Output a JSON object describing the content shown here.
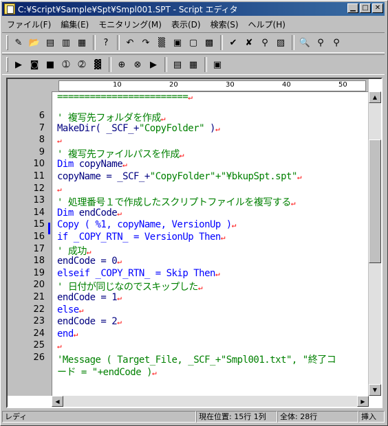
{
  "window": {
    "title": "C:¥Script¥Sample¥Spt¥Smpl001.SPT - Script エディタ"
  },
  "titlebar_buttons": [
    "▁",
    "□",
    "✕"
  ],
  "menu": [
    "ファイル(F)",
    "編集(E)",
    "モニタリング(M)",
    "表示(D)",
    "検索(S)",
    "ヘルプ(H)"
  ],
  "toolbar1": [
    {
      "name": "new-icon",
      "glyph": "✎"
    },
    {
      "name": "open-icon",
      "glyph": "📂"
    },
    {
      "name": "save-icon",
      "glyph": "▤"
    },
    {
      "name": "print-icon",
      "glyph": "▥"
    },
    {
      "name": "script-list-icon",
      "glyph": "▦"
    },
    {
      "sep": true
    },
    {
      "name": "help-icon",
      "glyph": "?"
    },
    {
      "sep": true
    },
    {
      "name": "undo-icon",
      "glyph": "↶"
    },
    {
      "name": "redo-icon",
      "glyph": "↷"
    },
    {
      "name": "cut-icon",
      "glyph": "▒"
    },
    {
      "name": "copy-icon",
      "glyph": "▣"
    },
    {
      "name": "paste-icon",
      "glyph": "▢"
    },
    {
      "name": "select-all-icon",
      "glyph": "▩"
    },
    {
      "sep": true
    },
    {
      "name": "check-icon",
      "glyph": "✔"
    },
    {
      "name": "debug-stop-icon",
      "glyph": "✘"
    },
    {
      "name": "binoculars-icon",
      "glyph": "⚲"
    },
    {
      "name": "property-icon",
      "glyph": "▨"
    },
    {
      "sep": true
    },
    {
      "name": "find-icon",
      "glyph": "🔍"
    },
    {
      "name": "find-next-icon",
      "glyph": "⚲"
    },
    {
      "name": "find-prev-icon",
      "glyph": "⚲"
    }
  ],
  "toolbar2": [
    {
      "name": "run-icon",
      "glyph": "▶"
    },
    {
      "name": "window-icon",
      "glyph": "◙"
    },
    {
      "name": "stop-icon",
      "glyph": "■"
    },
    {
      "name": "step-icon",
      "glyph": "➀"
    },
    {
      "name": "step-over-icon",
      "glyph": "➁"
    },
    {
      "name": "pause-icon",
      "glyph": "▓"
    },
    {
      "sep": true
    },
    {
      "name": "breakpoint-icon",
      "glyph": "⊕"
    },
    {
      "name": "clear-break-icon",
      "glyph": "⊗"
    },
    {
      "name": "trace-icon",
      "glyph": "▶"
    },
    {
      "sep": true
    },
    {
      "name": "watch-icon",
      "glyph": "▤"
    },
    {
      "name": "output-icon",
      "glyph": "▦"
    },
    {
      "sep": true
    },
    {
      "name": "env-icon",
      "glyph": "▣"
    }
  ],
  "ruler": {
    "labels": [
      "10",
      "20",
      "30",
      "40",
      "50"
    ]
  },
  "line_numbers": [
    "6",
    "7",
    "8",
    "9",
    "10",
    "11",
    "12",
    "13",
    "14",
    "15",
    "16",
    "17",
    "18",
    "19",
    "20",
    "21",
    "22",
    "23",
    "24",
    "25",
    "26"
  ],
  "code": [
    {
      "seg": [
        {
          "t": "========================",
          "c": "cmt"
        },
        {
          "t": "↵",
          "c": "mk"
        }
      ]
    },
    {
      "seg": [
        {
          "t": "' 複写先フォルダを作成",
          "c": "cmt"
        },
        {
          "t": "↵",
          "c": "mk"
        }
      ]
    },
    {
      "seg": [
        {
          "t": "MakeDir( _SCF_+",
          "c": "txt"
        },
        {
          "t": "\"CopyFolder\"",
          "c": "str"
        },
        {
          "t": " )",
          "c": "txt"
        },
        {
          "t": "↵",
          "c": "mk"
        }
      ]
    },
    {
      "seg": [
        {
          "t": "↵",
          "c": "mk"
        }
      ]
    },
    {
      "seg": [
        {
          "t": "' 複写先ファイルパスを作成",
          "c": "cmt"
        },
        {
          "t": "↵",
          "c": "mk"
        }
      ]
    },
    {
      "seg": [
        {
          "t": "Dim",
          "c": "kw"
        },
        {
          "t": " copyName",
          "c": "txt"
        },
        {
          "t": "↵",
          "c": "mk"
        }
      ]
    },
    {
      "seg": [
        {
          "t": "copyName = _SCF_+",
          "c": "txt"
        },
        {
          "t": "\"CopyFolder\"+\"¥bkupSpt.spt\"",
          "c": "str"
        },
        {
          "t": "↵",
          "c": "mk"
        }
      ]
    },
    {
      "seg": [
        {
          "t": "↵",
          "c": "mk"
        }
      ]
    },
    {
      "seg": [
        {
          "t": "' 処理番号１で作成したスクリプトファイルを複写する",
          "c": "cmt"
        },
        {
          "t": "↵",
          "c": "mk"
        }
      ]
    },
    {
      "seg": [
        {
          "t": "Dim",
          "c": "kw"
        },
        {
          "t": " endCode",
          "c": "txt"
        },
        {
          "t": "↵",
          "c": "mk"
        }
      ]
    },
    {
      "seg": [
        {
          "t": "Copy ( %1, copyName, VersionUp )",
          "c": "kw"
        },
        {
          "t": "↵",
          "c": "mk"
        }
      ]
    },
    {
      "seg": [
        {
          "t": "if _COPY_RTN_ = VersionUp Then",
          "c": "kw"
        },
        {
          "t": "↵",
          "c": "mk"
        }
      ]
    },
    {
      "seg": [
        {
          "t": "    ' 成功",
          "c": "cmt"
        },
        {
          "t": "↵",
          "c": "mk"
        }
      ]
    },
    {
      "seg": [
        {
          "t": "    endCode = 0",
          "c": "txt"
        },
        {
          "t": "↵",
          "c": "mk"
        }
      ]
    },
    {
      "seg": [
        {
          "t": "elseif _COPY_RTN_ = Skip Then",
          "c": "kw"
        },
        {
          "t": "↵",
          "c": "mk"
        }
      ]
    },
    {
      "seg": [
        {
          "t": "    ' 日付が同じなのでスキップした",
          "c": "cmt"
        },
        {
          "t": "↵",
          "c": "mk"
        }
      ]
    },
    {
      "seg": [
        {
          "t": "    endCode = 1",
          "c": "txt"
        },
        {
          "t": "↵",
          "c": "mk"
        }
      ]
    },
    {
      "seg": [
        {
          "t": "else",
          "c": "kw"
        },
        {
          "t": "↵",
          "c": "mk"
        }
      ]
    },
    {
      "seg": [
        {
          "t": "    endCode = 2",
          "c": "txt"
        },
        {
          "t": "↵",
          "c": "mk"
        }
      ]
    },
    {
      "seg": [
        {
          "t": "end",
          "c": "kw"
        },
        {
          "t": "↵",
          "c": "mk"
        }
      ]
    },
    {
      "seg": [
        {
          "t": "↵",
          "c": "mk"
        }
      ]
    },
    {
      "seg": [
        {
          "t": "'Message ( Target_File, _SCF_+\"Smpl001.txt\", \"終了コ",
          "c": "cmt"
        }
      ]
    },
    {
      "seg": [
        {
          "t": "ード = \"+endCode )",
          "c": "cmt"
        },
        {
          "t": "↵",
          "c": "mk"
        }
      ]
    }
  ],
  "status": {
    "mode": "レディ",
    "position_label": "現在位置:",
    "position_value": "15行 1列",
    "total_label": "全体:",
    "total_value": "28行",
    "insert": "挿入"
  }
}
